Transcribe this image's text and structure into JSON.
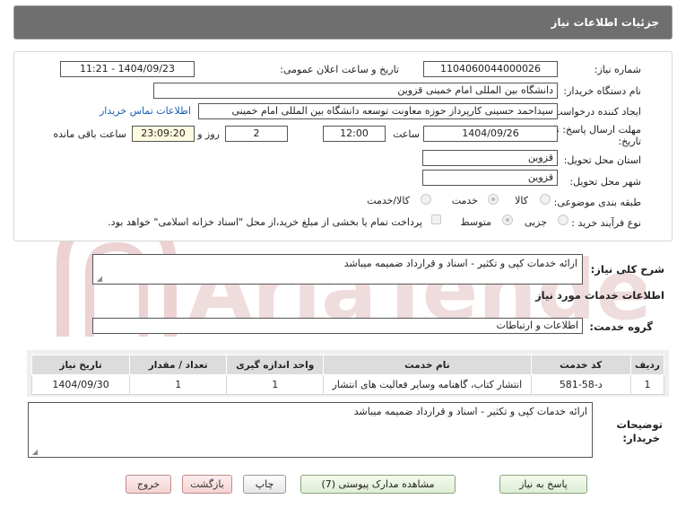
{
  "header": {
    "title": "جزئیات اطلاعات نیاز"
  },
  "form": {
    "need_number_label": "شماره نیاز:",
    "need_number": "1104060044000026",
    "announce_label": "تاریخ و ساعت اعلان عمومی:",
    "announce_value": "1404/09/23 - 11:21",
    "buyer_label": "نام دستگاه خریدار:",
    "buyer_value": "دانشگاه بین المللی امام خمینی قزوین",
    "requester_label": "ایجاد کننده درخواست:",
    "requester_value": "سیداحمد حسینی کارپرداز حوزه معاونت توسعه دانشگاه بین المللی امام خمینی",
    "contact_link": "اطلاعات تماس خریدار",
    "deadline_label_1": "مهلت ارسال پاسخ: تا",
    "deadline_label_2": "تاریخ:",
    "deadline_date": "1404/09/26",
    "time_label": "ساعت",
    "deadline_time": "12:00",
    "days_value": "2",
    "days_label": "روز و",
    "remaining_time": "23:09:20",
    "remaining_label": "ساعت باقی مانده",
    "province_label": "استان محل تحویل:",
    "province_value": "قزوین",
    "city_label": "شهر محل تحویل:",
    "city_value": "قزوین",
    "category_label": "طبقه بندی موضوعی:",
    "category_options": [
      "کالا",
      "خدمت",
      "کالا/خدمت"
    ],
    "process_label": "نوع فرآیند خرید :",
    "process_options": [
      "جزیی",
      "متوسط"
    ],
    "payment_note": "پرداخت تمام یا بخشی از مبلغ خرید،از محل \"اسناد خزانه اسلامی\" خواهد بود."
  },
  "summary": {
    "label": "شرح کلی نیاز:",
    "value": "ارائه خدمات کپی و تکثیر - اسناد و قرارداد ضمیمه میباشد"
  },
  "services": {
    "section_title": "اطلاعات خدمات مورد نیاز",
    "group_label": "گروه خدمت:",
    "group_value": "اطلاعات و ارتباطات",
    "columns": [
      "ردیف",
      "کد خدمت",
      "نام خدمت",
      "واحد اندازه گیری",
      "تعداد / مقدار",
      "تاریخ نیاز"
    ],
    "rows": [
      [
        "1",
        "د-58-581",
        "انتشار کتاب، گاهنامه وسایر فعالیت های انتشار",
        "1",
        "1",
        "1404/09/30"
      ]
    ]
  },
  "buyer_notes": {
    "label_1": "توضیحات",
    "label_2": "خریدار:",
    "value": "ارائه خدمات کپی و تکثیر - اسناد و قرارداد ضمیمه میباشد"
  },
  "buttons": {
    "reply": "پاسخ به نیاز",
    "docs": "مشاهده مدارک پیوستی (7)",
    "print": "چاپ",
    "back": "بازگشت",
    "exit": "خروج"
  },
  "colors": {
    "header": "#6f6f6f",
    "link": "#1a5fb4",
    "watermark": "#e8c4c4"
  }
}
